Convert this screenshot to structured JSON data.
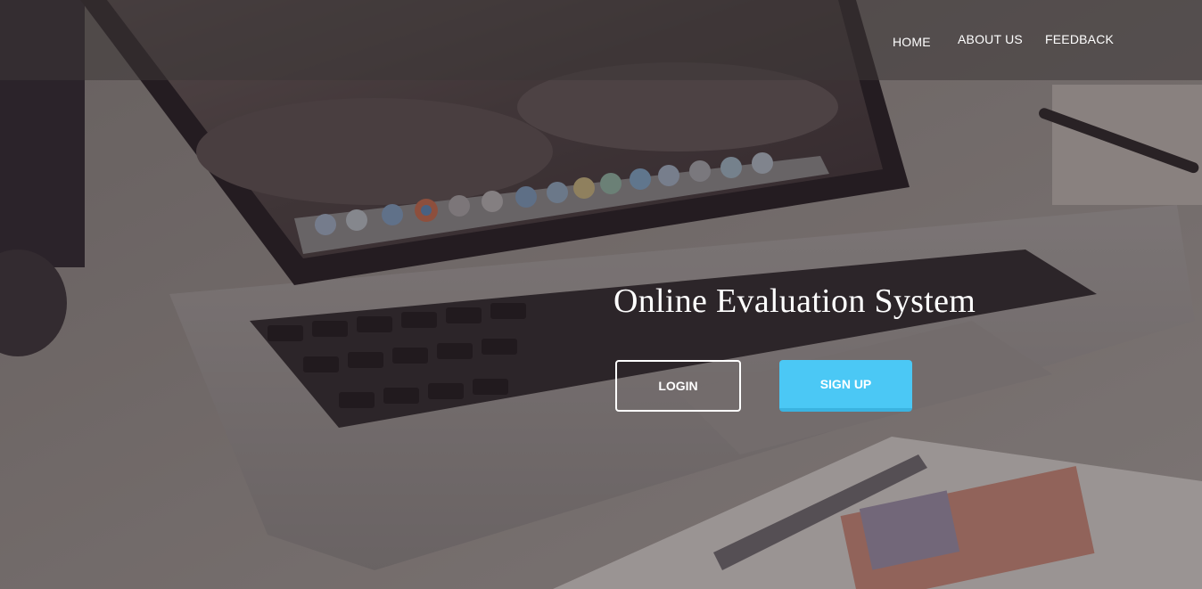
{
  "nav": {
    "home": "HOME",
    "about": "ABOUT US",
    "feedback": "FEEDBACK"
  },
  "hero": {
    "title": "Online Evaluation System",
    "login_label": "LOGIN",
    "signup_label": "SIGN UP"
  },
  "colors": {
    "signup_button": "#4bc8f5",
    "text": "#ffffff"
  }
}
